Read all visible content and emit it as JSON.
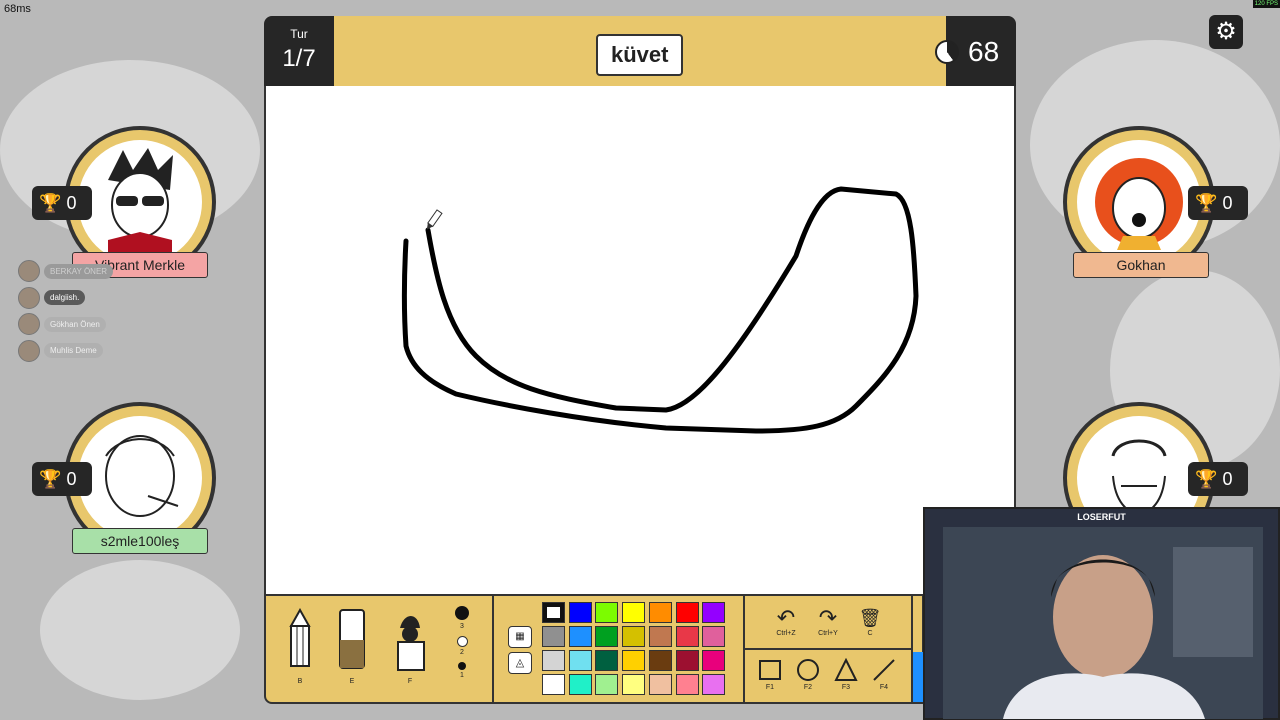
{
  "ping": "68ms",
  "fps": "120 FPS",
  "round": {
    "label": "Tur",
    "value": "1/7"
  },
  "word": "küvet",
  "timer": "68",
  "players": [
    {
      "name": "Vibrant Merkle",
      "score": "0",
      "name_bg": "#f4a4a4"
    },
    {
      "name": "Gokhan",
      "score": "0",
      "name_bg": "#f0b890"
    },
    {
      "name": "s2mle100leş",
      "score": "0",
      "name_bg": "#a8e0a8"
    },
    {
      "name": "",
      "score": "0",
      "name_bg": "#e8c76c"
    }
  ],
  "chat": [
    {
      "name": "BERKAY ÖNER",
      "bg": "#9a9a9a",
      "color": "#cfcfcf"
    },
    {
      "name": "dalgiish.",
      "bg": "#5a5a5a",
      "color": "#ffffff"
    },
    {
      "name": "Gökhan Önen",
      "bg": "#b0b0b0",
      "color": "#eeeeee"
    },
    {
      "name": "Muhlis Deme",
      "bg": "#b0b0b0",
      "color": "#eeeeee"
    }
  ],
  "tools": [
    {
      "key": "B",
      "icon": "pencil-icon"
    },
    {
      "key": "E",
      "icon": "eraser-icon"
    },
    {
      "key": "F",
      "icon": "fill-bucket-icon"
    }
  ],
  "brush_sizes": [
    "3",
    "2",
    "1"
  ],
  "palette": [
    "#ffffff",
    "#0000ff",
    "#7cfc00",
    "#ffff00",
    "#ff8c00",
    "#ff0000",
    "#9400ff",
    "#909090",
    "#1e90ff",
    "#00a020",
    "#d4c000",
    "#c07850",
    "#e83848",
    "#e0609c",
    "#d4d4d4",
    "#70e0f0",
    "#006040",
    "#ffd000",
    "#6a3c10",
    "#9c1030",
    "#e8007c",
    "#ffffff",
    "#20f0c8",
    "#a0f090",
    "#ffff80",
    "#f0c0a0",
    "#ff8090",
    "#e870f0"
  ],
  "actions": [
    {
      "key": "Ctrl+Z",
      "icon": "undo-icon",
      "glyph": "↶"
    },
    {
      "key": "Ctrl+Y",
      "icon": "redo-icon",
      "glyph": "↷"
    },
    {
      "key": "C",
      "icon": "trash-icon",
      "glyph": "🗑"
    }
  ],
  "shapes": [
    {
      "key": "F1",
      "icon": "rectangle-icon"
    },
    {
      "key": "F2",
      "icon": "circle-icon"
    },
    {
      "key": "F3",
      "icon": "triangle-icon"
    },
    {
      "key": "F4",
      "icon": "line-icon"
    }
  ],
  "webcam": {
    "title": "LOSERFUT"
  }
}
